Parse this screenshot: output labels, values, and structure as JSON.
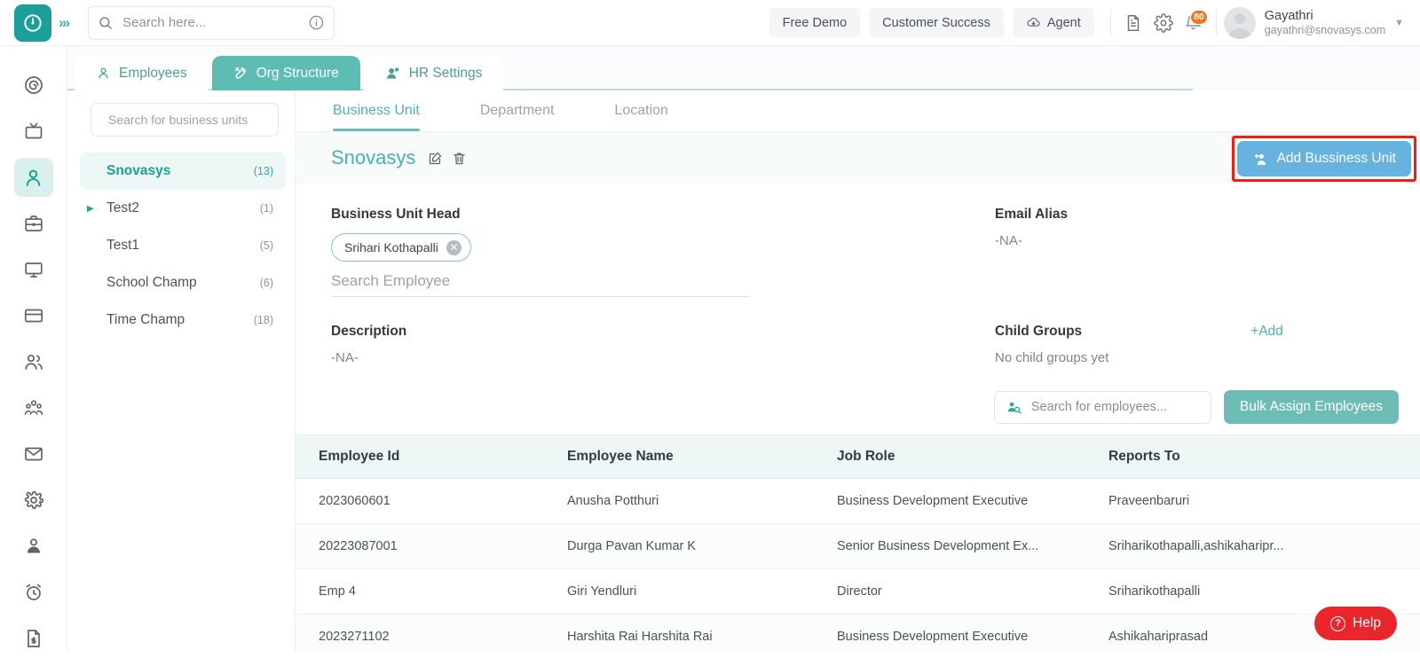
{
  "header": {
    "logo_icon": "clock-logo-icon",
    "expand_icon": "chevrons-right-icon",
    "search": {
      "placeholder": "Search here...",
      "value": "",
      "icon": "search-icon",
      "info_icon": "info-icon"
    },
    "buttons": [
      {
        "label": "Free Demo",
        "name": "free-demo-button",
        "icon": ""
      },
      {
        "label": "Customer Success",
        "name": "customer-success-button",
        "icon": ""
      },
      {
        "label": "Agent",
        "name": "agent-button",
        "icon": "cloud-download-icon"
      }
    ],
    "doc_icon": "document-icon",
    "settings_icon": "gear-icon",
    "bell_icon": "bell-icon",
    "notification_count": "80",
    "user": {
      "name": "Gayathri",
      "email": "gayathri@snovasys.com",
      "avatar": "avatar",
      "caret": "chevron-down-icon"
    }
  },
  "rail": {
    "items": [
      {
        "name": "sidebar-item-dashboard",
        "icon": "target-spiral-icon",
        "active": false
      },
      {
        "name": "sidebar-item-media",
        "icon": "tv-icon",
        "active": false
      },
      {
        "name": "sidebar-item-hr",
        "icon": "person-icon",
        "active": true
      },
      {
        "name": "sidebar-item-projects",
        "icon": "briefcase-icon",
        "active": false
      },
      {
        "name": "sidebar-item-desktop",
        "icon": "monitor-icon",
        "active": false
      },
      {
        "name": "sidebar-item-payroll",
        "icon": "credit-card-icon",
        "active": false
      },
      {
        "name": "sidebar-item-teams",
        "icon": "people-icon",
        "active": false
      },
      {
        "name": "sidebar-item-org",
        "icon": "group-icon",
        "active": false
      },
      {
        "name": "sidebar-item-mail",
        "icon": "mail-icon",
        "active": false
      },
      {
        "name": "sidebar-item-settings",
        "icon": "gear-icon",
        "active": false
      },
      {
        "name": "sidebar-item-profile",
        "icon": "user-icon",
        "active": false
      },
      {
        "name": "sidebar-item-attendance",
        "icon": "alarm-clock-icon",
        "active": false
      },
      {
        "name": "sidebar-item-invoice",
        "icon": "document-dollar-icon",
        "active": false
      }
    ]
  },
  "tabs": [
    {
      "label": "Employees",
      "icon": "person-icon",
      "active": false
    },
    {
      "label": "Org Structure",
      "icon": "tools-icon",
      "active": true
    },
    {
      "label": "HR Settings",
      "icon": "people-gear-icon",
      "active": false
    }
  ],
  "left_panel": {
    "search": {
      "placeholder": "Search for business units",
      "value": "",
      "icon": "search-icon"
    },
    "tree": [
      {
        "label": "Snovasys",
        "count": "(13)",
        "selected": true,
        "expandable": false
      },
      {
        "label": "Test2",
        "count": "(1)",
        "selected": false,
        "expandable": true
      },
      {
        "label": "Test1",
        "count": "(5)",
        "selected": false,
        "expandable": false
      },
      {
        "label": "School Champ",
        "count": "(6)",
        "selected": false,
        "expandable": false
      },
      {
        "label": "Time Champ",
        "count": "(18)",
        "selected": false,
        "expandable": false
      }
    ]
  },
  "subtabs": [
    {
      "label": "Business Unit",
      "active": true
    },
    {
      "label": "Department",
      "active": false
    },
    {
      "label": "Location",
      "active": false
    }
  ],
  "bu": {
    "title": "Snovasys",
    "edit_icon": "edit-icon",
    "delete_icon": "trash-icon",
    "add_button": {
      "label": "Add Bussiness Unit",
      "icon": "add-person-icon",
      "color": "#66b3e0",
      "highlight_color": "#f51d11"
    },
    "head_label": "Business Unit Head",
    "head_chip": "Srihari Kothapalli",
    "head_chip_remove_icon": "close-circle-icon",
    "employee_search_placeholder": "Search Employee",
    "employee_search_value": "",
    "description_label": "Description",
    "description_value": "-NA-",
    "email_alias_label": "Email Alias",
    "email_alias_value": "-NA-",
    "child_groups_label": "Child Groups",
    "child_groups_value": "No child groups yet",
    "child_groups_add": "+Add"
  },
  "toolbar": {
    "search": {
      "placeholder": "Search for employees...",
      "value": "",
      "icon": "person-search-icon"
    },
    "bulk_assign_label": "Bulk Assign Employees"
  },
  "table": {
    "columns": [
      "Employee Id",
      "Employee Name",
      "Job Role",
      "Reports To"
    ],
    "rows": [
      {
        "id": "2023060601",
        "name": "Anusha Potthuri",
        "role": "Business Development Executive",
        "reports": "Praveenbaruri"
      },
      {
        "id": "20223087001",
        "name": "Durga Pavan Kumar K",
        "role": "Senior Business Development Ex...",
        "reports": "Sriharikothapalli,ashikaharipr..."
      },
      {
        "id": "Emp 4",
        "name": "Giri Yendluri",
        "role": "Director",
        "reports": "Sriharikothapalli"
      },
      {
        "id": "2023271102",
        "name": "Harshita Rai Harshita Rai",
        "role": "Business Development Executive",
        "reports": "Ashikahariprasad"
      }
    ]
  },
  "help": {
    "label": "Help",
    "icon": "question-circle-icon",
    "color": "#e8262b"
  }
}
